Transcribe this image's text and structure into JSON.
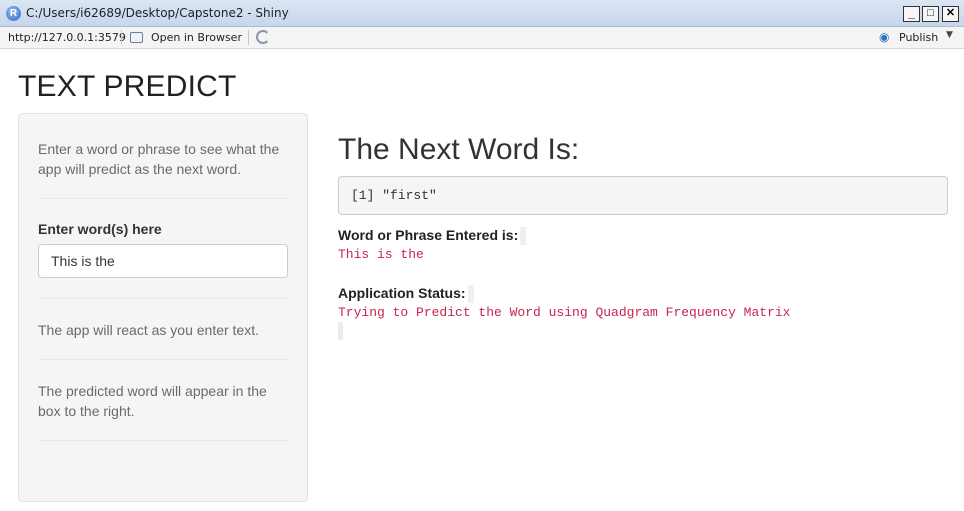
{
  "window": {
    "title": "C:/Users/i62689/Desktop/Capstone2 - Shiny",
    "minimize": "_",
    "maximize": "□",
    "close": "✕"
  },
  "toolbar": {
    "url": "http://127.0.0.1:3579",
    "open_in_browser": "Open in Browser",
    "publish": "Publish",
    "icons": [
      "open-browser-icon",
      "refresh-icon",
      "publish-icon",
      "chevron-down-icon"
    ]
  },
  "app": {
    "title": "TEXT PREDICT",
    "sidebar": {
      "intro": "Enter a word or phrase to see what the app will predict as the next word.",
      "input_label": "Enter word(s) here",
      "input_value": "This is the",
      "react_note": "The app will react as you enter text.",
      "result_note": "The predicted word will appear in the box to the right."
    },
    "main": {
      "heading": "The Next Word Is:",
      "prediction_output": "[1] \"first\"",
      "entered_label": "Word or Phrase Entered is:",
      "entered_value": "This is the",
      "status_label": "Application Status:",
      "status_value": "Trying to Predict the Word using Quadgram Frequency Matrix"
    }
  },
  "colors": {
    "code_text": "#c7254e",
    "sidebar_bg": "#f5f5f5",
    "titlebar": "#c6d6ec"
  }
}
